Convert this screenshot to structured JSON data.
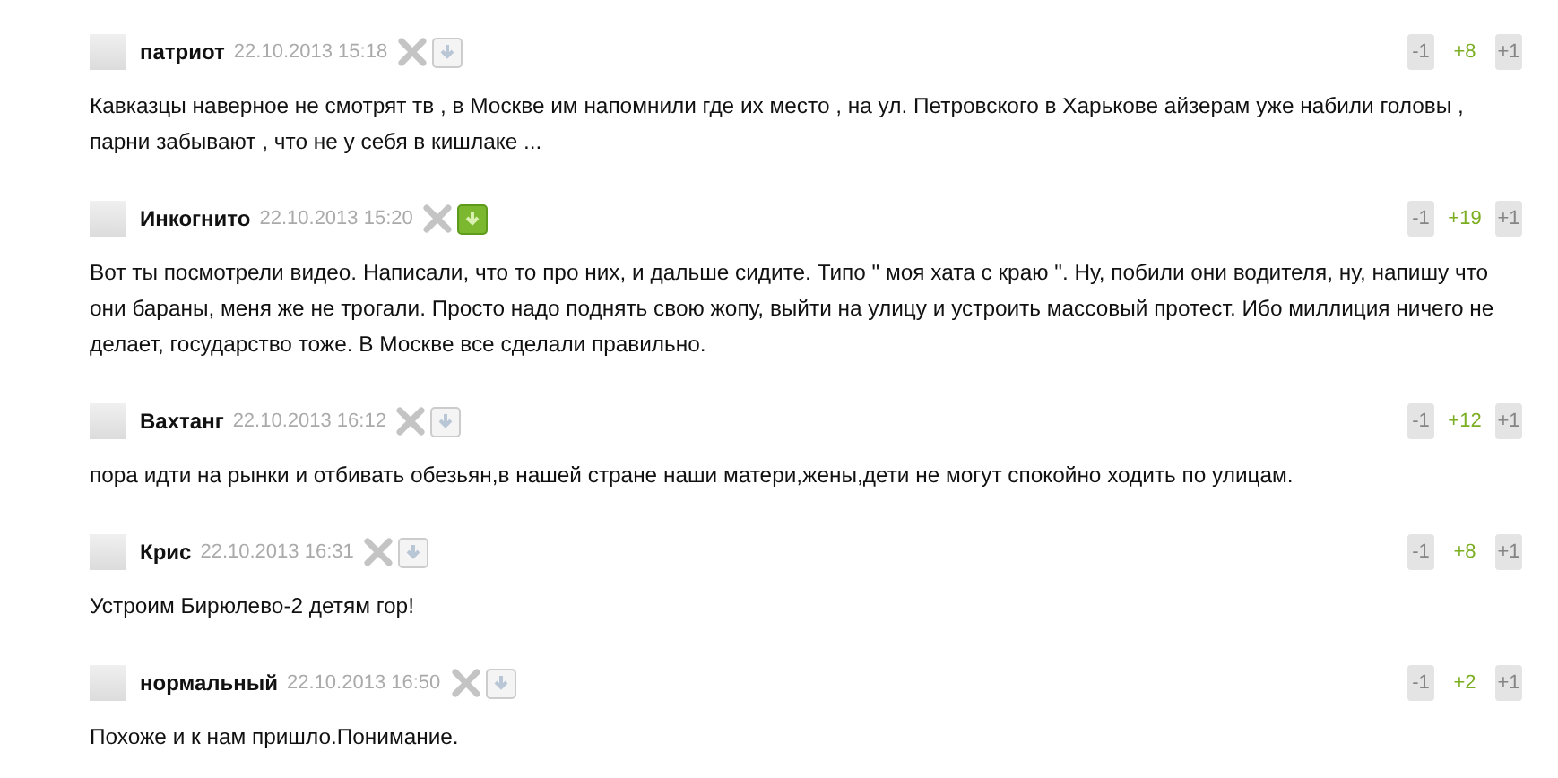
{
  "comments": [
    {
      "author": "патриот",
      "date": "22.10.2013 15:18",
      "saved": false,
      "minus": "-1",
      "score": "+8",
      "plus": "+1",
      "text": "Кавказцы наверное не смотрят тв , в Москве им напомнили где их место , на ул. Петровского в Харькове айзерам уже набили головы , парни забывают , что не у себя в кишлаке ..."
    },
    {
      "author": "Инкогнито",
      "date": "22.10.2013 15:20",
      "saved": true,
      "minus": "-1",
      "score": "+19",
      "plus": "+1",
      "text": "Вот ты посмотрели видео. Написали, что то про них, и дальше сидите. Типо \" моя хата с краю \". Ну, побили они водителя, ну, напишу что они бараны, меня же не трогали. Просто надо поднять свою жопу, выйти на улицу и устроить массовый протест. Ибо миллиция ничего не делает, государство тоже. В Москве все сделали правильно."
    },
    {
      "author": "Вахтанг",
      "date": "22.10.2013 16:12",
      "saved": false,
      "minus": "-1",
      "score": "+12",
      "plus": "+1",
      "text": "пора идти на рынки и отбивать обезьян,в нашей стране наши матери,жены,дети не могут спокойно ходить по улицам."
    },
    {
      "author": "Крис",
      "date": "22.10.2013 16:31",
      "saved": false,
      "minus": "-1",
      "score": "+8",
      "plus": "+1",
      "text": "Устроим Бирюлево-2 детям гор!"
    },
    {
      "author": "нормальный",
      "date": "22.10.2013 16:50",
      "saved": false,
      "minus": "-1",
      "score": "+2",
      "plus": "+1",
      "text": "Похоже и к нам пришло.Понимание."
    }
  ]
}
